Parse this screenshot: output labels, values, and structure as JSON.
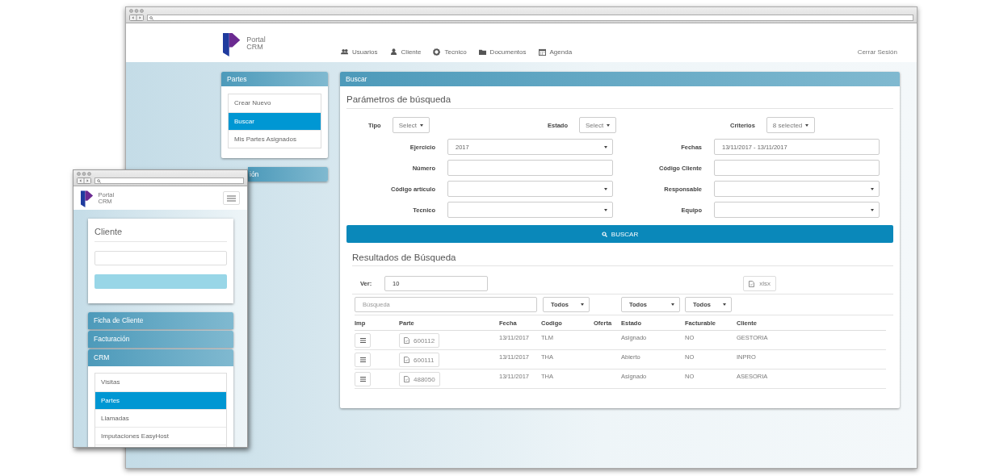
{
  "desktop": {
    "logo": {
      "line1": "Portal",
      "line2": "CRM"
    },
    "nav": [
      {
        "kind": "users",
        "label": "Usuarios"
      },
      {
        "kind": "user",
        "label": "Cliente"
      },
      {
        "kind": "gear",
        "label": "Tecnico"
      },
      {
        "kind": "folder",
        "label": "Documentos"
      },
      {
        "kind": "calendar",
        "label": "Agenda"
      }
    ],
    "logout": "Cerrar Sesión",
    "sidebar": [
      {
        "title": "Partes",
        "expanded": true,
        "items": [
          {
            "label": "Crear Nuevo",
            "selected": false
          },
          {
            "label": "Buscar",
            "selected": true
          },
          {
            "label": "Mis Partes Asignados",
            "selected": false
          }
        ]
      },
      {
        "title": "ión",
        "expanded": false
      }
    ],
    "search_panel": {
      "title": "Buscar",
      "heading": "Parámetros de búsqueda",
      "dropdowns": [
        {
          "label": "Tipo",
          "value": "Select"
        },
        {
          "label": "Estado",
          "value": "Select"
        },
        {
          "label": "Criterios",
          "value": "8 selected"
        }
      ],
      "fields": [
        {
          "label": "Ejercicio",
          "kind": "select",
          "value": "2017"
        },
        {
          "label": "Fechas",
          "kind": "text",
          "value": "13/11/2017 - 13/11/2017"
        },
        {
          "label": "Número",
          "kind": "text"
        },
        {
          "label": "Código Cliente",
          "kind": "text"
        },
        {
          "label": "Código artículo",
          "kind": "select"
        },
        {
          "label": "Responsable",
          "kind": "select"
        },
        {
          "label": "Tecnico",
          "kind": "select"
        },
        {
          "label": "Equipo",
          "kind": "select"
        }
      ],
      "button": "BUSCAR"
    },
    "results": {
      "title": "Resultados de Búsqueda",
      "ver_label": "Ver:",
      "ver_value": "10",
      "export": "xlsx",
      "filters": [
        {
          "kind": "search",
          "placeholder": "Búsqueda"
        },
        {
          "kind": "select",
          "value": "Todos"
        },
        {
          "kind": "select",
          "value": "Todos"
        },
        {
          "kind": "select",
          "value": "Todos"
        }
      ],
      "columns": [
        "Imp",
        "Parte",
        "Fecha",
        "Codigo",
        "Oferta",
        "Estado",
        "Facturable",
        "Cliente"
      ],
      "rows": [
        {
          "parte": "600112",
          "fecha": "13/11/2017",
          "codigo": "TLM",
          "estado": "Asignado",
          "facturable": "NO",
          "cliente": "GESTORIA"
        },
        {
          "parte": "600111",
          "fecha": "13/11/2017",
          "codigo": "THA",
          "estado": "Abierto",
          "facturable": "NO",
          "cliente": "INPRO"
        },
        {
          "parte": "488050",
          "fecha": "13/11/2017",
          "codigo": "THA",
          "estado": "Asignado",
          "facturable": "NO",
          "cliente": "ASESORIA"
        }
      ]
    }
  },
  "mobile": {
    "logo": {
      "line1": "Portal",
      "line2": "CRM"
    },
    "card": {
      "title": "Cliente"
    },
    "panels": [
      {
        "title": "Ficha de Cliente",
        "expanded": false
      },
      {
        "title": "Facturación",
        "expanded": false
      },
      {
        "title": "CRM",
        "expanded": true,
        "items": [
          {
            "label": "Visitas",
            "selected": false
          },
          {
            "label": "Partes",
            "selected": true
          },
          {
            "label": "Llamadas",
            "selected": false
          },
          {
            "label": "Imputaciones EasyHost",
            "selected": false
          }
        ]
      }
    ]
  }
}
